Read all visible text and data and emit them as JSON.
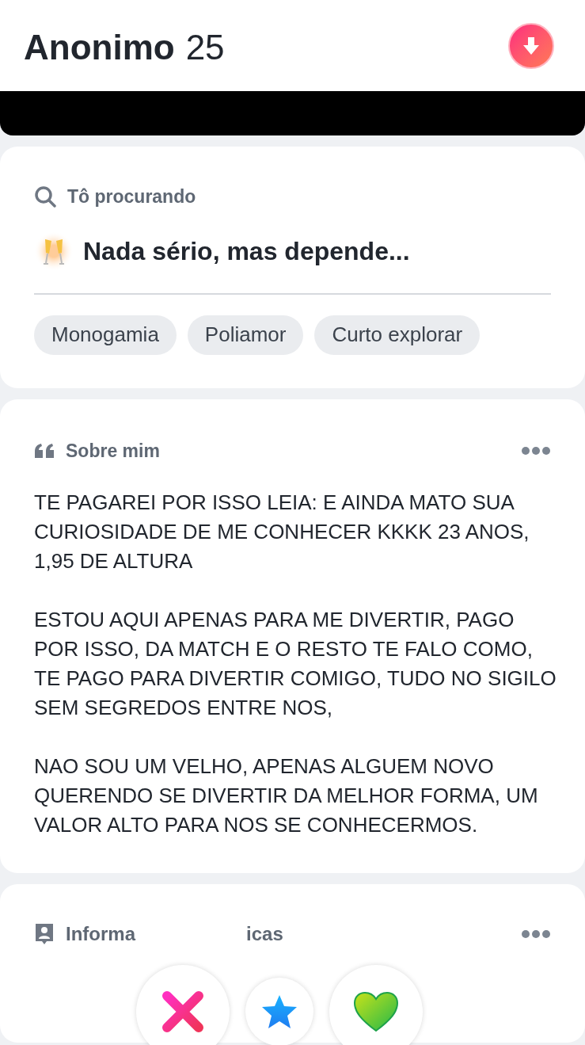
{
  "header": {
    "name": "Anonimo",
    "age": "25"
  },
  "looking_for": {
    "label": "Tô procurando",
    "value": "Nada sério, mas depende...",
    "tags": [
      "Monogamia",
      "Poliamor",
      "Curto explorar"
    ]
  },
  "about": {
    "label": "Sobre mim",
    "paragraphs": [
      "TE PAGAREI POR ISSO LEIA: E AINDA MATO SUA CURIOSIDADE DE ME CONHECER KKKK 23 ANOS, 1,95 DE ALTURA",
      "ESTOU AQUI APENAS PARA ME DIVERTIR, PAGO POR ISSO, DA MATCH E O RESTO TE FALO COMO, TE PAGO PARA DIVERTIR COMIGO, TUDO NO SIGILO SEM SEGREDOS ENTRE NOS,",
      "NAO SOU UM VELHO, APENAS ALGUEM NOVO QUERENDO SE DIVERTIR DA MELHOR FORMA, UM VALOR ALTO PARA NOS SE CONHECERMOS."
    ]
  },
  "basics": {
    "label_start": "Informa",
    "label_end": "icas"
  },
  "actions": [
    {
      "kind": "nope"
    },
    {
      "kind": "super"
    },
    {
      "kind": "like"
    }
  ]
}
